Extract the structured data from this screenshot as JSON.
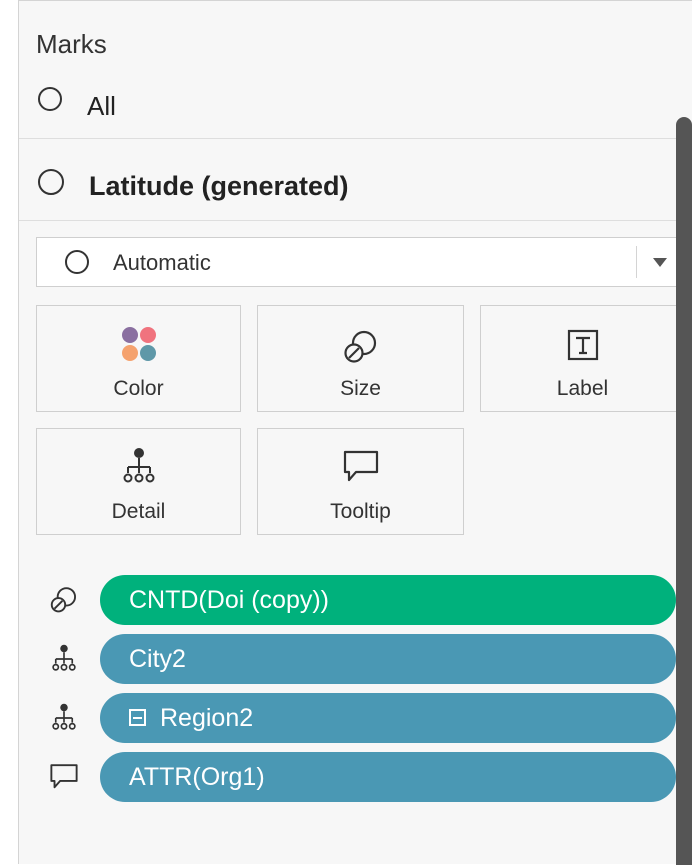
{
  "marks": {
    "title": "Marks",
    "all_label": "All",
    "layer_label": "Latitude (generated)",
    "mark_type": {
      "selected": "Automatic"
    },
    "cards": [
      {
        "key": "color",
        "label": "Color",
        "icon": "color-palette-icon"
      },
      {
        "key": "size",
        "label": "Size",
        "icon": "size-icon"
      },
      {
        "key": "label",
        "label": "Label",
        "icon": "text-label-icon"
      },
      {
        "key": "detail",
        "label": "Detail",
        "icon": "detail-hierarchy-icon"
      },
      {
        "key": "tooltip",
        "label": "Tooltip",
        "icon": "tooltip-speech-icon"
      }
    ],
    "fields": [
      {
        "icon": "size-icon",
        "label": "CNTD(Doi (copy))",
        "color": "#00b17c",
        "collapsible": false
      },
      {
        "icon": "detail-hierarchy-icon",
        "label": "City2",
        "color": "#4a98b4",
        "collapsible": false
      },
      {
        "icon": "detail-hierarchy-icon",
        "label": "Region2",
        "color": "#4a98b4",
        "collapsible": true
      },
      {
        "icon": "tooltip-speech-icon",
        "label": "ATTR(Org1)",
        "color": "#4a98b4",
        "collapsible": false
      }
    ]
  },
  "colors": {
    "measure_pill": "#00b17c",
    "dimension_pill": "#4a98b4",
    "palette_dots": [
      "#8a6fa0",
      "#f0737e",
      "#f5a26e",
      "#5f98a8"
    ]
  }
}
